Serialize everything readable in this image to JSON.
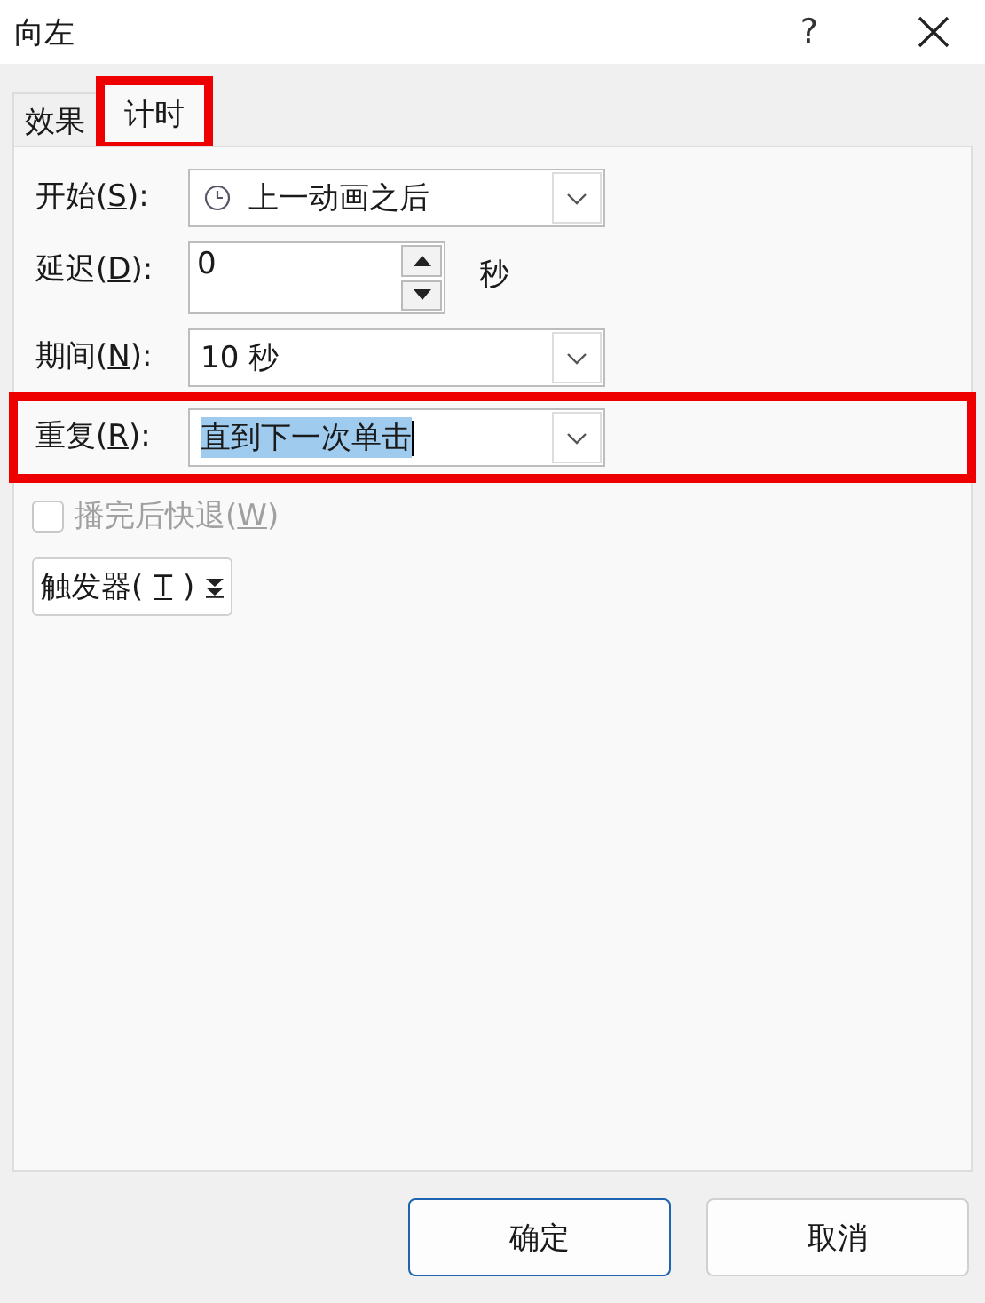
{
  "window": {
    "title": "向左",
    "help": "?"
  },
  "tabs": [
    {
      "label": "效果",
      "selected": false,
      "highlighted": false
    },
    {
      "label": "计时",
      "selected": true,
      "highlighted": true
    }
  ],
  "fields": [
    {
      "kind": "clock_combo",
      "label": "开始(",
      "hotkey": "S",
      "label_end": "):",
      "value": "上一动画之后"
    },
    {
      "kind": "spin",
      "label": "延迟(",
      "hotkey": "D",
      "label_end": "):",
      "value": "0",
      "unit": "秒"
    },
    {
      "kind": "combo",
      "label": "期间(",
      "hotkey": "N",
      "label_end": "):",
      "value": "10 秒"
    },
    {
      "kind": "combo",
      "label": "重复(",
      "hotkey": "R",
      "label_end": "):",
      "value": "直到下一次单击",
      "highlighted": true,
      "text_selected": true
    }
  ],
  "rewind": {
    "label": "播完后快退(",
    "hotkey": "W",
    "label_end": ")",
    "checked": false,
    "disabled": true
  },
  "trigger": {
    "label": "触发器(",
    "hotkey": "T",
    "label_end": ")"
  },
  "buttons": [
    {
      "label": "确定",
      "default": true
    },
    {
      "label": "取消",
      "default": false
    }
  ]
}
